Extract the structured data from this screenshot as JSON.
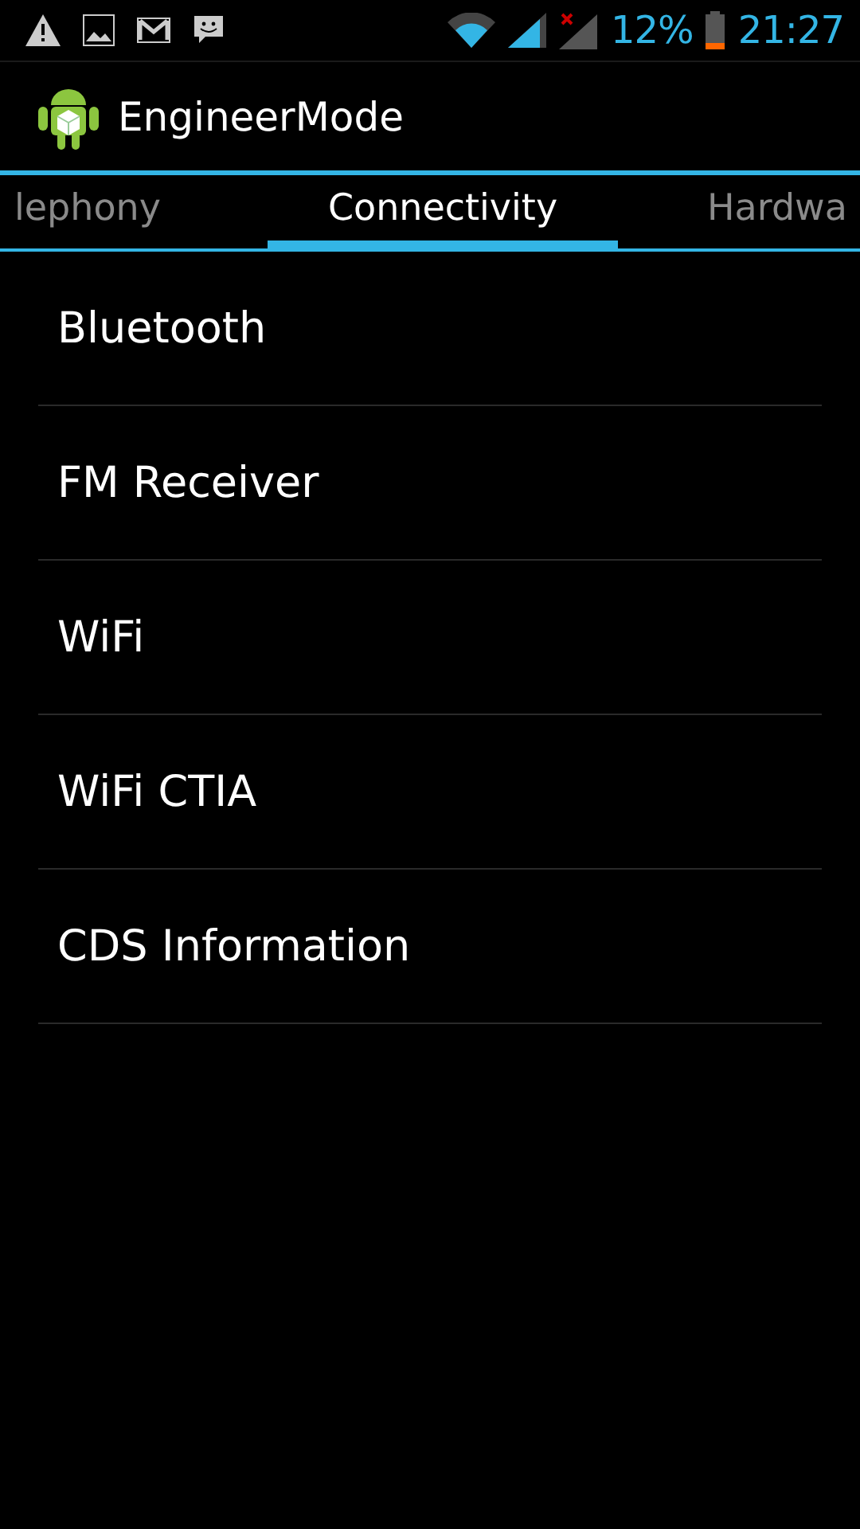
{
  "status_bar": {
    "battery": "12%",
    "time": "21:27"
  },
  "action_bar": {
    "title": "EngineerMode"
  },
  "tabs": [
    {
      "label": "lephony",
      "selected": false
    },
    {
      "label": "Connectivity",
      "selected": true
    },
    {
      "label": "Hardwa",
      "selected": false
    }
  ],
  "items": [
    {
      "label": "Bluetooth"
    },
    {
      "label": "FM Receiver"
    },
    {
      "label": "WiFi"
    },
    {
      "label": "WiFi CTIA"
    },
    {
      "label": "CDS Information"
    }
  ]
}
